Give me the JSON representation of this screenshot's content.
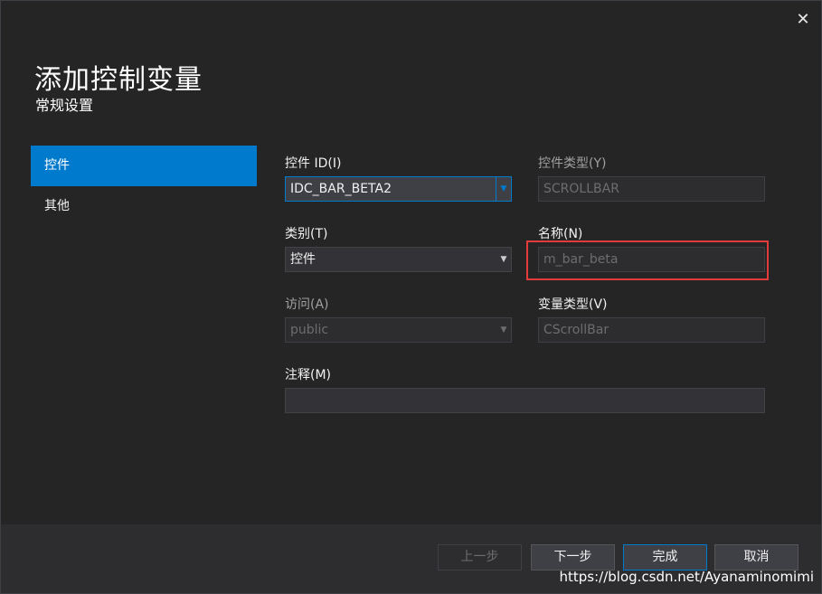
{
  "dialog": {
    "title": "添加控制变量",
    "subtitle": "常规设置",
    "close_glyph": "✕"
  },
  "nav": {
    "items": [
      {
        "label": "控件",
        "active": true
      },
      {
        "label": "其他",
        "active": false
      }
    ]
  },
  "fields": {
    "control_id": {
      "label": "控件 ID(I)",
      "value": "IDC_BAR_BETA2"
    },
    "control_type": {
      "label": "控件类型(Y)",
      "value": "SCROLLBAR"
    },
    "category": {
      "label": "类别(T)",
      "value": "控件"
    },
    "name": {
      "label": "名称(N)",
      "value": "m_bar_beta"
    },
    "access": {
      "label": "访问(A)",
      "value": "public"
    },
    "variable_type": {
      "label": "变量类型(V)",
      "value": "CScrollBar"
    },
    "comment": {
      "label": "注释(M)",
      "value": ""
    }
  },
  "buttons": {
    "prev": "上一步",
    "next": "下一步",
    "finish": "完成",
    "cancel": "取消"
  },
  "watermark": "https://blog.csdn.net/Ayanaminomimi",
  "colors": {
    "accent": "#007acc",
    "highlight_border": "#e23b3b",
    "background": "#252526"
  }
}
